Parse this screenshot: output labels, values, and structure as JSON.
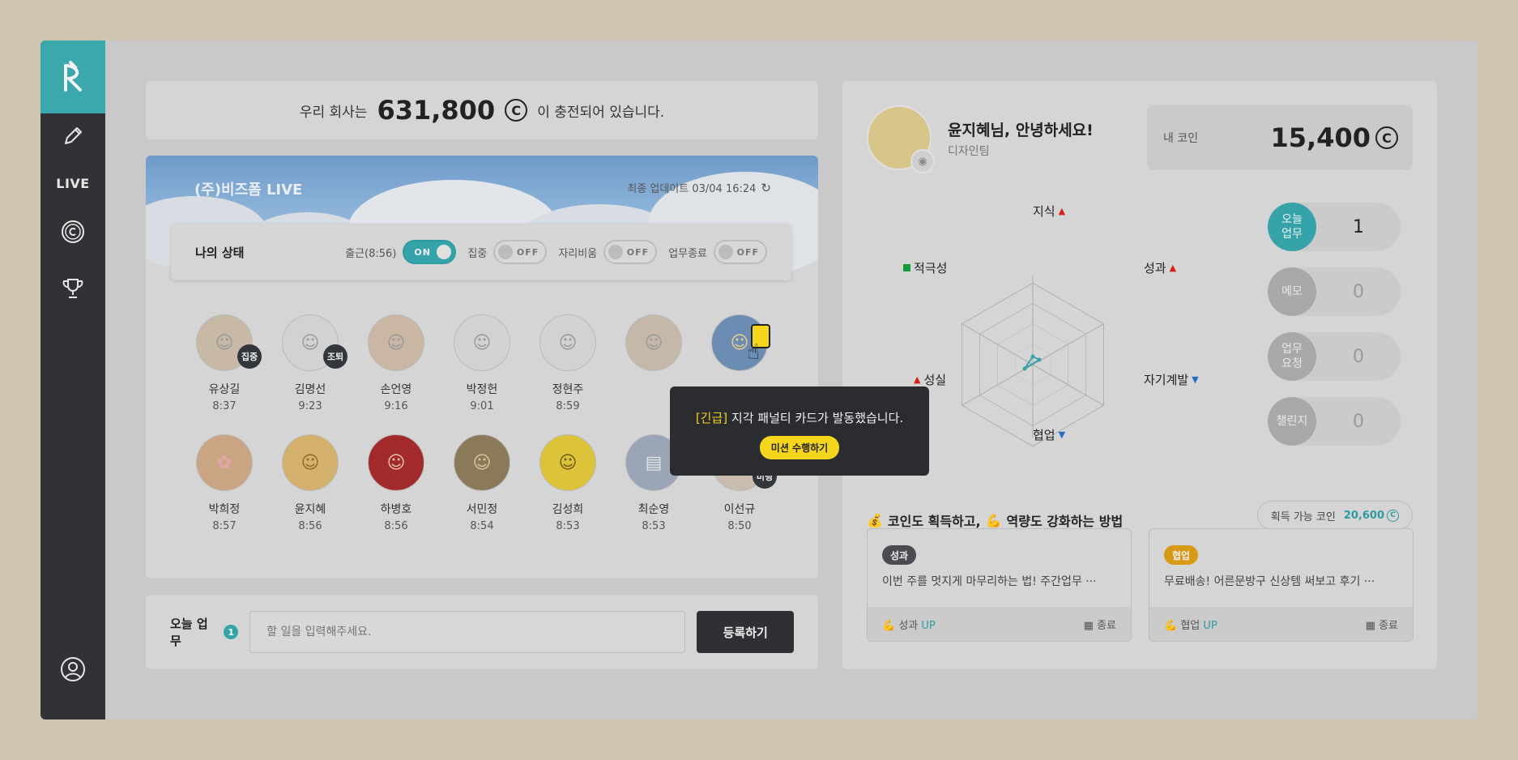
{
  "sidebar": {
    "live_label": "LIVE"
  },
  "balance": {
    "prefix": "우리 회사는",
    "amount": "631,800",
    "suffix": "이 충전되어 있습니다."
  },
  "live": {
    "title": "(주)비즈폼 LIVE",
    "update": "최종 업데이트 03/04 16:24",
    "status_label": "나의 상태",
    "toggles": [
      {
        "label": "출근(8:56)",
        "state": "ON"
      },
      {
        "label": "집중",
        "state": "OFF"
      },
      {
        "label": "자리비움",
        "state": "OFF"
      },
      {
        "label": "업무종료",
        "state": "OFF"
      }
    ],
    "people": [
      {
        "name": "유상길",
        "time": "8:37",
        "badge": "집중"
      },
      {
        "name": "김명선",
        "time": "9:23",
        "badge": "조퇴"
      },
      {
        "name": "손언영",
        "time": "9:16",
        "badge": ""
      },
      {
        "name": "박정헌",
        "time": "9:01",
        "badge": ""
      },
      {
        "name": "정현주",
        "time": "8:59",
        "badge": ""
      },
      {
        "name": "",
        "time": "",
        "badge": ""
      },
      {
        "name": "",
        "time": "",
        "badge": ""
      },
      {
        "name": "박희정",
        "time": "8:57",
        "badge": ""
      },
      {
        "name": "윤지혜",
        "time": "8:56",
        "badge": ""
      },
      {
        "name": "하병호",
        "time": "8:56",
        "badge": ""
      },
      {
        "name": "서민정",
        "time": "8:54",
        "badge": ""
      },
      {
        "name": "김성희",
        "time": "8:53",
        "badge": ""
      },
      {
        "name": "최순영",
        "time": "8:53",
        "badge": ""
      },
      {
        "name": "이선규",
        "time": "8:50",
        "badge": "미팅"
      }
    ]
  },
  "popup": {
    "urgent": "[긴급]",
    "message": "지각 패널티 카드가 발동했습니다.",
    "button": "미션 수행하기"
  },
  "task": {
    "label": "오늘 업무",
    "count": "1",
    "placeholder": "할 일을 입력해주세요.",
    "button": "등록하기"
  },
  "profile": {
    "greeting": "윤지혜님, 안녕하세요!",
    "team": "디자인팀",
    "coin_label": "내 코인",
    "coin_value": "15,400"
  },
  "radar": {
    "labels": {
      "knowledge": "지식",
      "performance": "성과",
      "development": "자기계발",
      "collaboration": "협업",
      "sincerity": "성실",
      "proactive": "적극성"
    }
  },
  "stats": [
    {
      "label": "오늘\n업무",
      "value": "1"
    },
    {
      "label": "메모",
      "value": "0"
    },
    {
      "label": "업무\n요청",
      "value": "0"
    },
    {
      "label": "챌린지",
      "value": "0"
    }
  ],
  "howto": {
    "part1": "코인도 획득하고,",
    "part2": "역량도 강화하는 방법",
    "earn_label": "획득 가능 코인",
    "earn_value": "20,600"
  },
  "missions": [
    {
      "tag": "성과",
      "title": "이번 주를 멋지게 마무리하는 법! 주간업무 ···",
      "foot_label": "성과",
      "foot_up": "UP",
      "end": "종료"
    },
    {
      "tag": "협업",
      "title": "무료배송! 어른문방구 신상템 써보고 후기 ···",
      "foot_label": "협업",
      "foot_up": "UP",
      "end": "종료"
    }
  ],
  "colors": {
    "accent": "#35a4aa",
    "sidebar": "#313236",
    "urgent": "#f4d020"
  }
}
